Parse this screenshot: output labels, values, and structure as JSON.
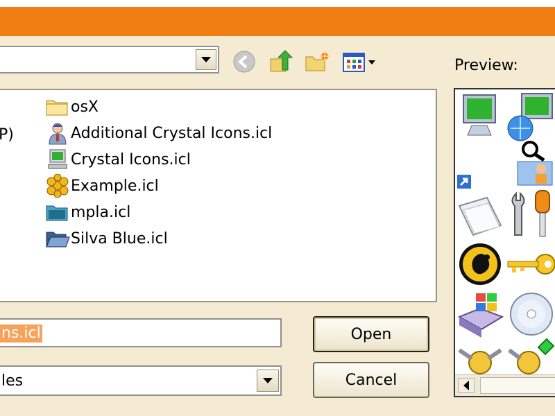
{
  "dialog": {
    "look_in_value": "",
    "preview_label": "Preview:",
    "left_fragment": "P)",
    "filename_value": "ns.icl",
    "filetype_value": "les",
    "open_label": "Open",
    "cancel_label": "Cancel"
  },
  "toolbar": {
    "icons": [
      "back-icon",
      "up-folder-icon",
      "new-folder-icon",
      "view-menu-icon"
    ]
  },
  "files": [
    {
      "name": "osX",
      "icon": "folder-icon"
    },
    {
      "name": "Additional Crystal Icons.icl",
      "icon": "user-icon"
    },
    {
      "name": "Crystal Icons.icl",
      "icon": "computer-icon"
    },
    {
      "name": "Example.icl",
      "icon": "honeycomb-icon"
    },
    {
      "name": "mpla.icl",
      "icon": "mpla-folder-icon"
    },
    {
      "name": "Silva Blue.icl",
      "icon": "open-folder-icon"
    }
  ],
  "colors": {
    "title_bar": "#f07e13",
    "dialog_bg": "#f4ebd2",
    "selection": "#f5a35a"
  }
}
